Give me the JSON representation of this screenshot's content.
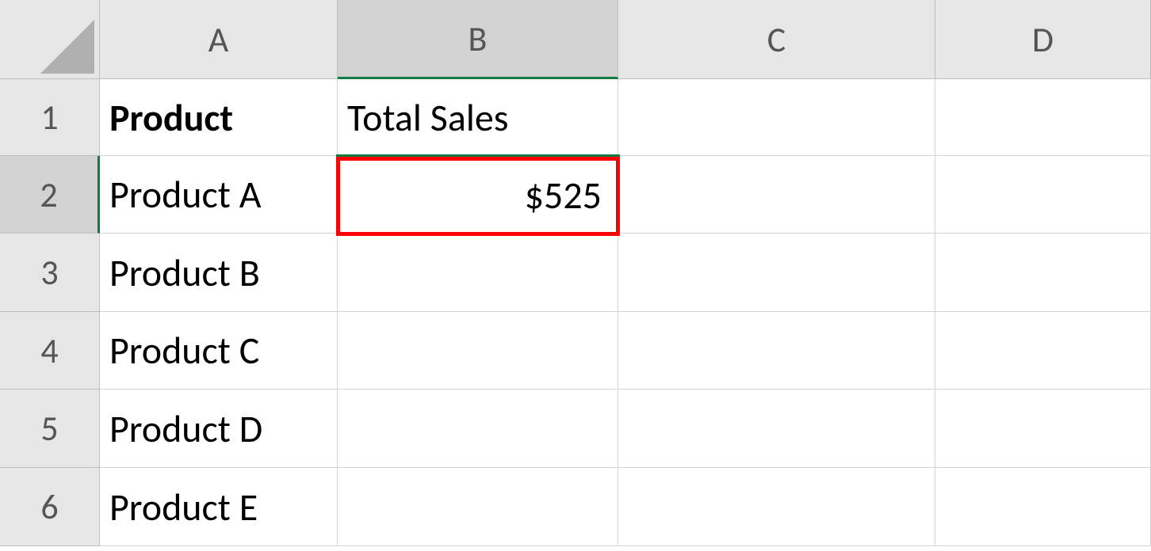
{
  "columns": [
    "A",
    "B",
    "C",
    "D"
  ],
  "rows": [
    "1",
    "2",
    "3",
    "4",
    "5",
    "6"
  ],
  "cells": {
    "A1": "Product",
    "B1": "Total Sales",
    "A2": "Product A",
    "B2": "$525",
    "A3": "Product B",
    "A4": "Product C",
    "A5": "Product D",
    "A6": "Product E"
  },
  "active_cell": "B2",
  "selected_column": "B",
  "selected_row": "2"
}
